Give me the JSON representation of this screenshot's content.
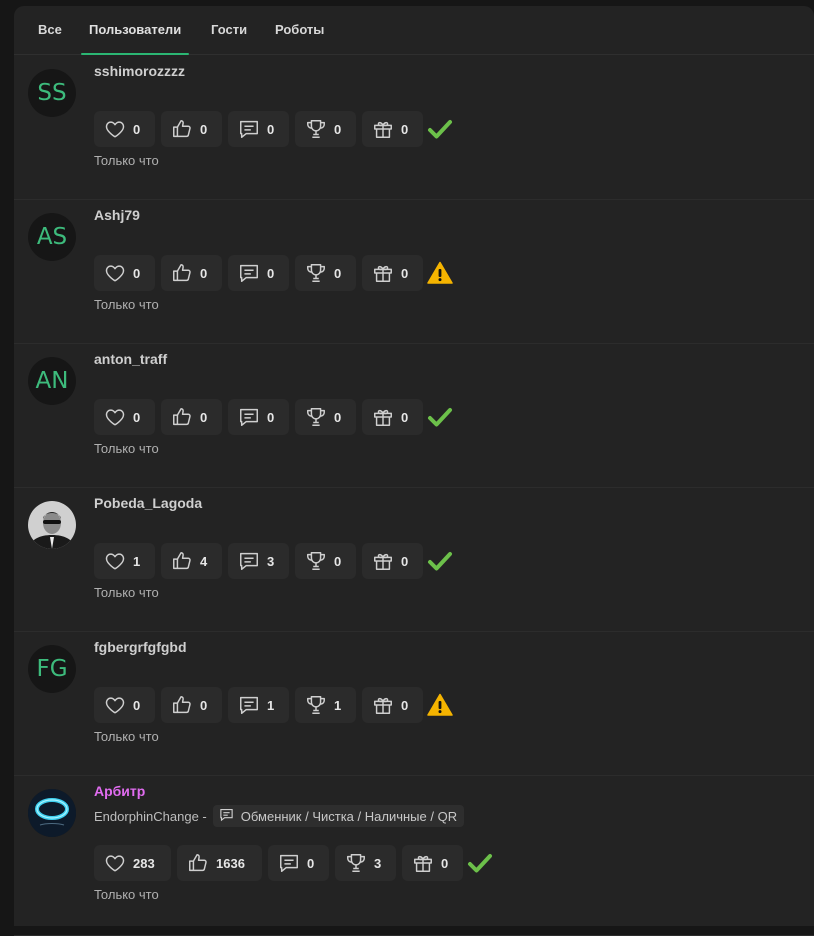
{
  "tabs": [
    "Все",
    "Пользователи",
    "Гости",
    "Роботы"
  ],
  "active_tab": 1,
  "users": [
    {
      "initials": "SS",
      "name": "sshimorozzzz",
      "stats": [
        0,
        0,
        0,
        0,
        0
      ],
      "status": "ok",
      "time": "Только что"
    },
    {
      "initials": "AS",
      "name": "Ashj79",
      "stats": [
        0,
        0,
        0,
        0,
        0
      ],
      "status": "warning",
      "time": "Только что"
    },
    {
      "initials": "AN",
      "name": "anton_traff",
      "stats": [
        0,
        0,
        0,
        0,
        0
      ],
      "status": "ok",
      "time": "Только что"
    },
    {
      "initials": "",
      "name": "Pobeda_Lagoda",
      "stats": [
        1,
        4,
        3,
        0,
        0
      ],
      "status": "ok",
      "time": "Только что"
    },
    {
      "initials": "FG",
      "name": "fgbergrfgfgbd",
      "stats": [
        0,
        0,
        1,
        1,
        0
      ],
      "status": "warning",
      "time": "Только что"
    },
    {
      "initials": "",
      "name": "Арбитр",
      "subtitle": "EndorphinChange -",
      "badge": "Обменник / Чистка / Наличные / QR",
      "stats": [
        283,
        1636,
        0,
        3,
        0
      ],
      "status": "ok",
      "time": "Только что"
    }
  ],
  "stat_icons": [
    "heart-icon",
    "thumbs-up-icon",
    "comment-icon",
    "trophy-icon",
    "gift-icon"
  ],
  "status_icons": {
    "ok": "check-icon",
    "warning": "warning-icon"
  },
  "colors": {
    "accent": "#2bb673",
    "initials": "#3dbb7c",
    "check": "#6cc04a",
    "warning": "#f5b400",
    "arbiter_name": "#e16cf0"
  }
}
